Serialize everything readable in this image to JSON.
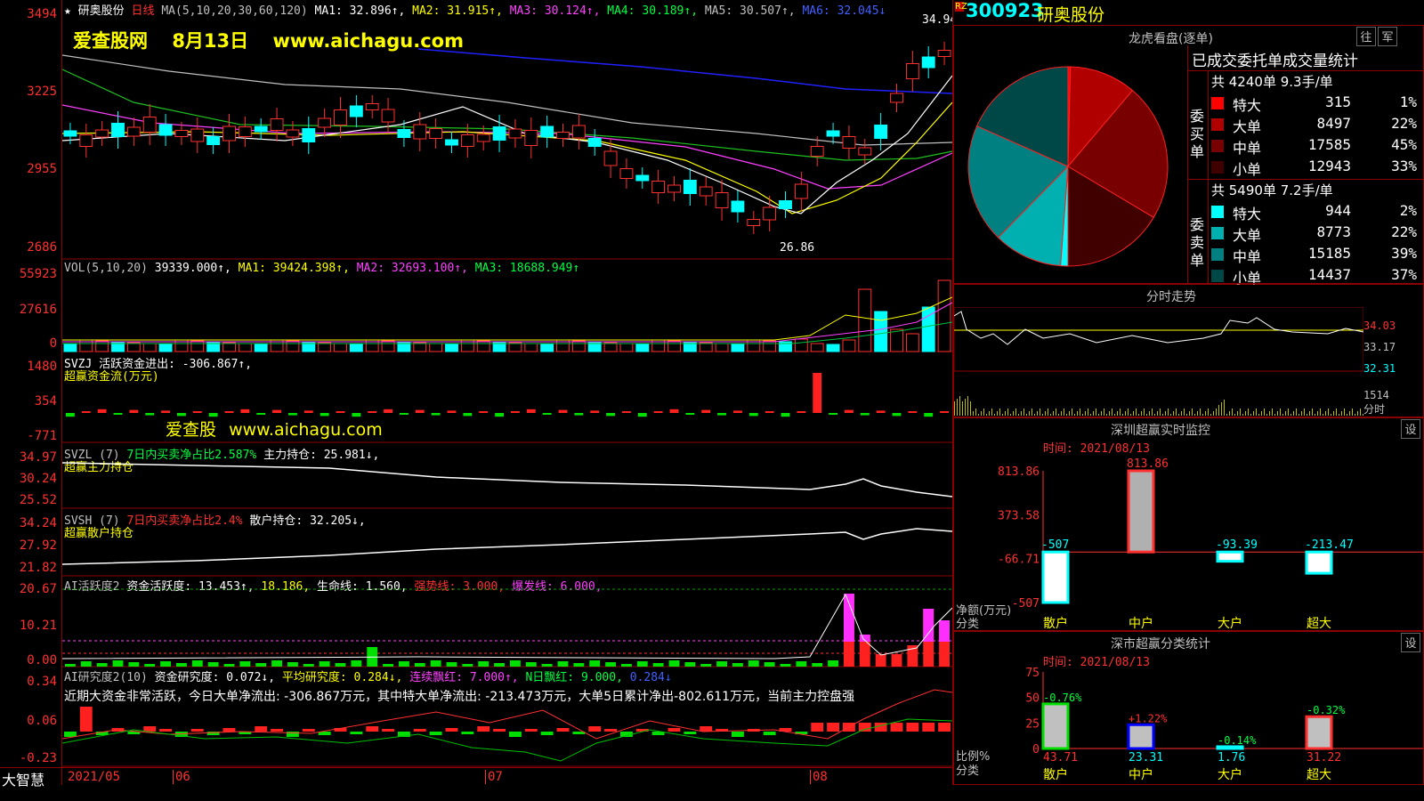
{
  "main_chart": {
    "star": "★",
    "stock_name": "研奥股份",
    "period": "日线",
    "ma_def": "MA(5,10,20,30,60,120)",
    "ma1": "MA1: 32.896↑,",
    "ma2": "MA2: 31.915↑,",
    "ma3": "MA3: 30.124↑,",
    "ma4": "MA4: 30.189↑,",
    "ma5": "MA5: 30.507↑,",
    "ma6": "MA6: 32.045↓",
    "y_labels": [
      "3494",
      "3225",
      "2955",
      "2686"
    ],
    "high_label": "34.94",
    "low_label": "26.86",
    "watermark_site": "爱查股网",
    "watermark_date": "8月13日",
    "watermark_url": "www.aichagu.com"
  },
  "volume_panel": {
    "def": "VOL(5,10,20)",
    "vol": "39339.000↑,",
    "ma1": "MA1: 39424.398↑,",
    "ma2": "MA2: 32693.100↑,",
    "ma3": "MA3: 18688.949↑",
    "y_labels": [
      "55923",
      "27616",
      "0"
    ]
  },
  "svzj_panel": {
    "line1": "SVZJ  活跃资金进出: -306.867↑,",
    "line2": "超赢资金流(万元)",
    "watermark_cn": "爱查股",
    "watermark_url": "www.aichagu.com",
    "y_labels": [
      "1480",
      "354",
      "-771"
    ]
  },
  "svzl_panel": {
    "name": "SVZL (7)",
    "ratio": "7日内买卖净占比2.587%",
    "hold": "主力持仓: 25.981↓,",
    "line2": "超赢主力持仓",
    "y_labels": [
      "34.97",
      "30.24",
      "25.52"
    ]
  },
  "svsh_panel": {
    "name": "SVSH (7)",
    "ratio": "7日内买卖净占比2.4%",
    "hold": "散户持仓: 32.205↓,",
    "line2": "超赢散户持仓",
    "y_labels": [
      "34.24",
      "27.92",
      "21.82"
    ]
  },
  "ai_active": {
    "name": "AI活跃度2",
    "v1": "资金活跃度: 13.453↑,",
    "v2": "18.186,",
    "v3": "生命线: 1.560,",
    "v4": "强势线: 3.000,",
    "v5": "爆发线: 6.000,",
    "y_labels": [
      "20.67",
      "10.21",
      "0.00"
    ]
  },
  "ai_research": {
    "name": "AI研究度2(10)",
    "v1": "资金研究度: 0.072↓,",
    "v2": "平均研究度: 0.284↓,",
    "v3": "连续飘红: 7.000↑,",
    "v4": "N日飘红: 9.000,",
    "v5": "0.284↓",
    "summary": "近期大资金非常活跃，今日大单净流出: -306.867万元，其中特大单净流出: -213.473万元，大单5日累计净出-802.611万元，当前主力控盘强",
    "y_labels": [
      "0.34",
      "0.06",
      "-0.23"
    ]
  },
  "bottom_bar": {
    "brand": "大智慧",
    "dates": [
      "2021/05",
      "06",
      "07",
      "08"
    ]
  },
  "right": {
    "rz": "RZ",
    "code": "300923",
    "name": "研奥股份",
    "lhb_title": "龙虎看盘(逐单)",
    "tab1": "往",
    "tab2": "军",
    "stats_title": "已成交委托单成交量统计",
    "buy_summary": "共 4240单 9.3手/单",
    "buy_label": "委买单",
    "buy_rows": [
      {
        "label": "特大",
        "vol": "315",
        "pct": "1%",
        "color": "#ff0000"
      },
      {
        "label": "大单",
        "vol": "8497",
        "pct": "22%",
        "color": "#b00000"
      },
      {
        "label": "中单",
        "vol": "17585",
        "pct": "45%",
        "color": "#780000"
      },
      {
        "label": "小单",
        "vol": "12943",
        "pct": "33%",
        "color": "#400000"
      }
    ],
    "sell_summary": "共 5490单 7.2手/单",
    "sell_label": "委卖单",
    "sell_rows": [
      {
        "label": "特大",
        "vol": "944",
        "pct": "2%",
        "color": "#00ffff"
      },
      {
        "label": "大单",
        "vol": "8773",
        "pct": "22%",
        "color": "#00b0b0"
      },
      {
        "label": "中单",
        "vol": "15185",
        "pct": "39%",
        "color": "#008080"
      },
      {
        "label": "小单",
        "vol": "14437",
        "pct": "37%",
        "color": "#004848"
      }
    ],
    "intraday_title": "分时走势",
    "intraday_labels": [
      "34.03",
      "33.17",
      "32.31",
      "1514",
      "分时"
    ],
    "sz_monitor_title": "深圳超赢实时监控",
    "sz_monitor_set": "设",
    "sz_time": "时间: 2021/08/13",
    "sz_y": [
      "813.86",
      "373.58",
      "-66.71",
      "-507"
    ],
    "sz_bars": [
      {
        "cat": "散户",
        "value": -507,
        "label": "-507"
      },
      {
        "cat": "中户",
        "value": 813.86,
        "label": "813.86"
      },
      {
        "cat": "大户",
        "value": -93.39,
        "label": "-93.39"
      },
      {
        "cat": "超大",
        "value": -213.47,
        "label": "-213.47"
      }
    ],
    "sz_unit1": "净额(万元)",
    "sz_unit2": "分类",
    "cls_title": "深市超赢分类统计",
    "cls_set": "设",
    "cls_time": "时间: 2021/08/13",
    "cls_y": [
      "75",
      "50",
      "25",
      "0"
    ],
    "cls_bars": [
      {
        "cat": "散户",
        "value": 43.71,
        "label": "43.71",
        "chg": "-0.76%"
      },
      {
        "cat": "中户",
        "value": 23.31,
        "label": "23.31",
        "chg": "+1.22%"
      },
      {
        "cat": "大户",
        "value": 1.76,
        "label": "1.76",
        "chg": "-0.14%"
      },
      {
        "cat": "超大",
        "value": 31.22,
        "label": "31.22",
        "chg": "-0.32%"
      }
    ],
    "cls_unit1": "比例%",
    "cls_unit2": "分类"
  }
}
